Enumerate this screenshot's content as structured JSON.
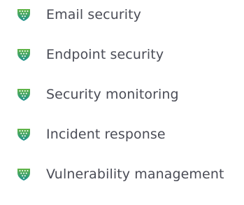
{
  "items": [
    {
      "label": "Email security",
      "icon": "shield-mesh-icon"
    },
    {
      "label": "Endpoint security",
      "icon": "shield-mesh-icon"
    },
    {
      "label": "Security monitoring",
      "icon": "shield-mesh-icon"
    },
    {
      "label": "Incident response",
      "icon": "shield-mesh-icon"
    },
    {
      "label": "Vulnerability management",
      "icon": "shield-mesh-icon"
    }
  ],
  "colors": {
    "text": "#4a4c56",
    "icon_top": "#63b544",
    "icon_bottom": "#1b8f8e"
  }
}
